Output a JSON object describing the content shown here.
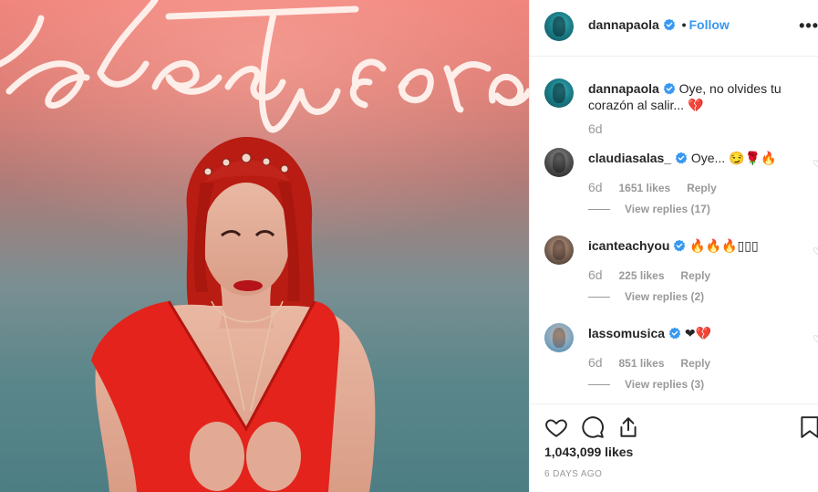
{
  "post": {
    "author": "dannapaola",
    "follow_label": "Follow",
    "separator": "•",
    "more_label": "•••",
    "photo": {
      "neon_text": "idestu coraz",
      "neon_color": "#fff4ef",
      "background_top": "#ee7f77",
      "background_bottom": "#4d7e84",
      "dress_color": "#e3231c",
      "hair_color": "#b81c12"
    }
  },
  "caption": {
    "username": "dannapaola",
    "text": "Oye, no olvides tu corazón al salir... 💔",
    "age": "6d"
  },
  "comments": [
    {
      "username": "claudiasalas_",
      "text": "Oye... 😏🌹🔥",
      "age": "6d",
      "likes": "1651 likes",
      "reply": "Reply",
      "view_replies": "View replies (17)"
    },
    {
      "username": "icanteachyou",
      "text": "🔥🔥🔥▯▯▯",
      "age": "6d",
      "likes": "225 likes",
      "reply": "Reply",
      "view_replies": "View replies (2)"
    },
    {
      "username": "lassomusica",
      "text": "❤💔",
      "age": "6d",
      "likes": "851 likes",
      "reply": "Reply",
      "view_replies": "View replies (3)"
    }
  ],
  "footer": {
    "likes": "1,043,099 likes",
    "time_ago": "6 DAYS AGO"
  },
  "icons": {
    "verified": "verified-badge-icon",
    "like": "heart-icon",
    "comment": "comment-icon",
    "share": "share-icon",
    "save": "bookmark-icon"
  },
  "colors": {
    "link": "#3897f0",
    "verified": "#3897f0",
    "muted": "#999999",
    "text": "#262626"
  }
}
